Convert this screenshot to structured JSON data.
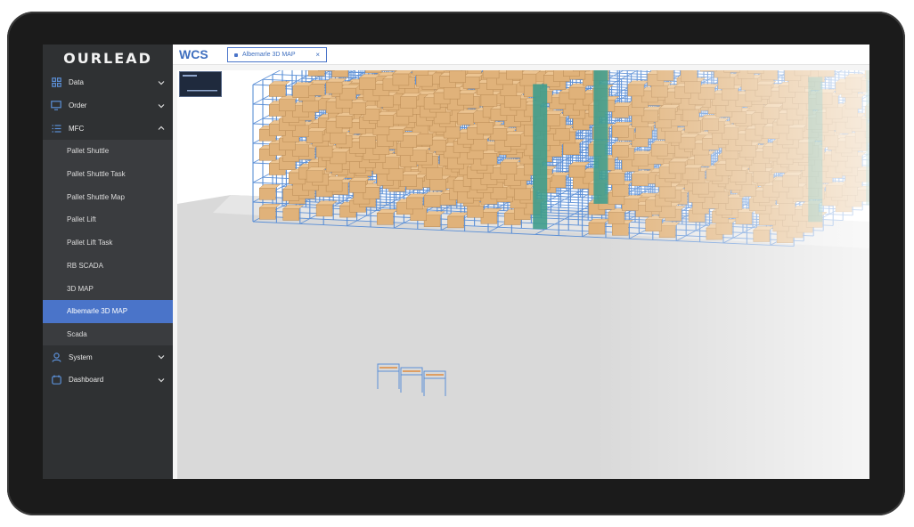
{
  "sidebar": {
    "logo": "OURLEAD",
    "items": [
      {
        "label": "Data",
        "icon": "grid-icon"
      },
      {
        "label": "Order",
        "icon": "monitor-icon"
      },
      {
        "label": "MFC",
        "icon": "list-icon"
      }
    ],
    "mfc_subitems": [
      {
        "label": "Pallet Shuttle"
      },
      {
        "label": "Pallet Shuttle Task"
      },
      {
        "label": "Pallet Shuttle Map"
      },
      {
        "label": "Pallet Lift"
      },
      {
        "label": "Pallet Lift Task"
      },
      {
        "label": "RB SCADA"
      },
      {
        "label": "3D MAP"
      },
      {
        "label": "Albemarle 3D MAP"
      },
      {
        "label": "Scada"
      }
    ],
    "bottom_items": [
      {
        "label": "System",
        "icon": "user-icon"
      },
      {
        "label": "Dashboard",
        "icon": "dashboard-icon"
      }
    ],
    "active_item": "Albemarle 3D MAP"
  },
  "header": {
    "brand": "WCS",
    "tabs": [
      {
        "label": "Albemarle 3D MAP",
        "close": "×"
      }
    ]
  },
  "colors": {
    "sidebar_bg": "#2f3133",
    "accent": "#4a74c9",
    "rack_blue": "#5b8fd6",
    "box_tan": "#e0b27a",
    "lift_teal": "#3f9c8c"
  }
}
